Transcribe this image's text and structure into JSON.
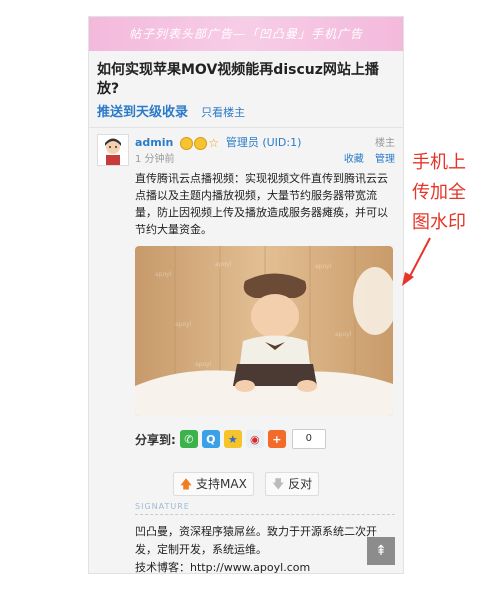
{
  "banner": {
    "text": "帖子列表头部广告—「凹凸曼」手机广告"
  },
  "thread": {
    "title": "如何实现苹果MOV视频能再discuz网站上播放?",
    "push_link": "推送到天级收录",
    "op_only": "只看楼主"
  },
  "post": {
    "author": "admin",
    "role": "管理员 (UID:1)",
    "time": "1 分钟前",
    "floor": "楼主",
    "favorite": "收藏",
    "manage": "管理",
    "content": "直传腾讯云点播视频：实现视频文件直传到腾讯云云点播以及主题内播放视频，大量节约服务器带宽流量，防止因视频上传及播放造成服务器瘫痪，并可以节约大量资金。"
  },
  "share": {
    "label": "分享到:",
    "count": "0",
    "icons": [
      "wechat-icon",
      "qq-icon",
      "qzone-icon",
      "weibo-icon",
      "more-icon"
    ]
  },
  "vote": {
    "support": "支持MAX",
    "oppose": "反对"
  },
  "signature": {
    "label": "SIGNATURE",
    "line1": "凹凸曼，资深程序猿屌丝。致力于开源系统二次开发，定制开发，系统运维。",
    "line2": "技术博客：http://www.apoyl.com"
  },
  "annotation": {
    "text": "手机上传加全图水印"
  },
  "colors": {
    "link": "#2b7bc9",
    "banner": "#f3b9dc",
    "annotation": "#e5352a"
  }
}
